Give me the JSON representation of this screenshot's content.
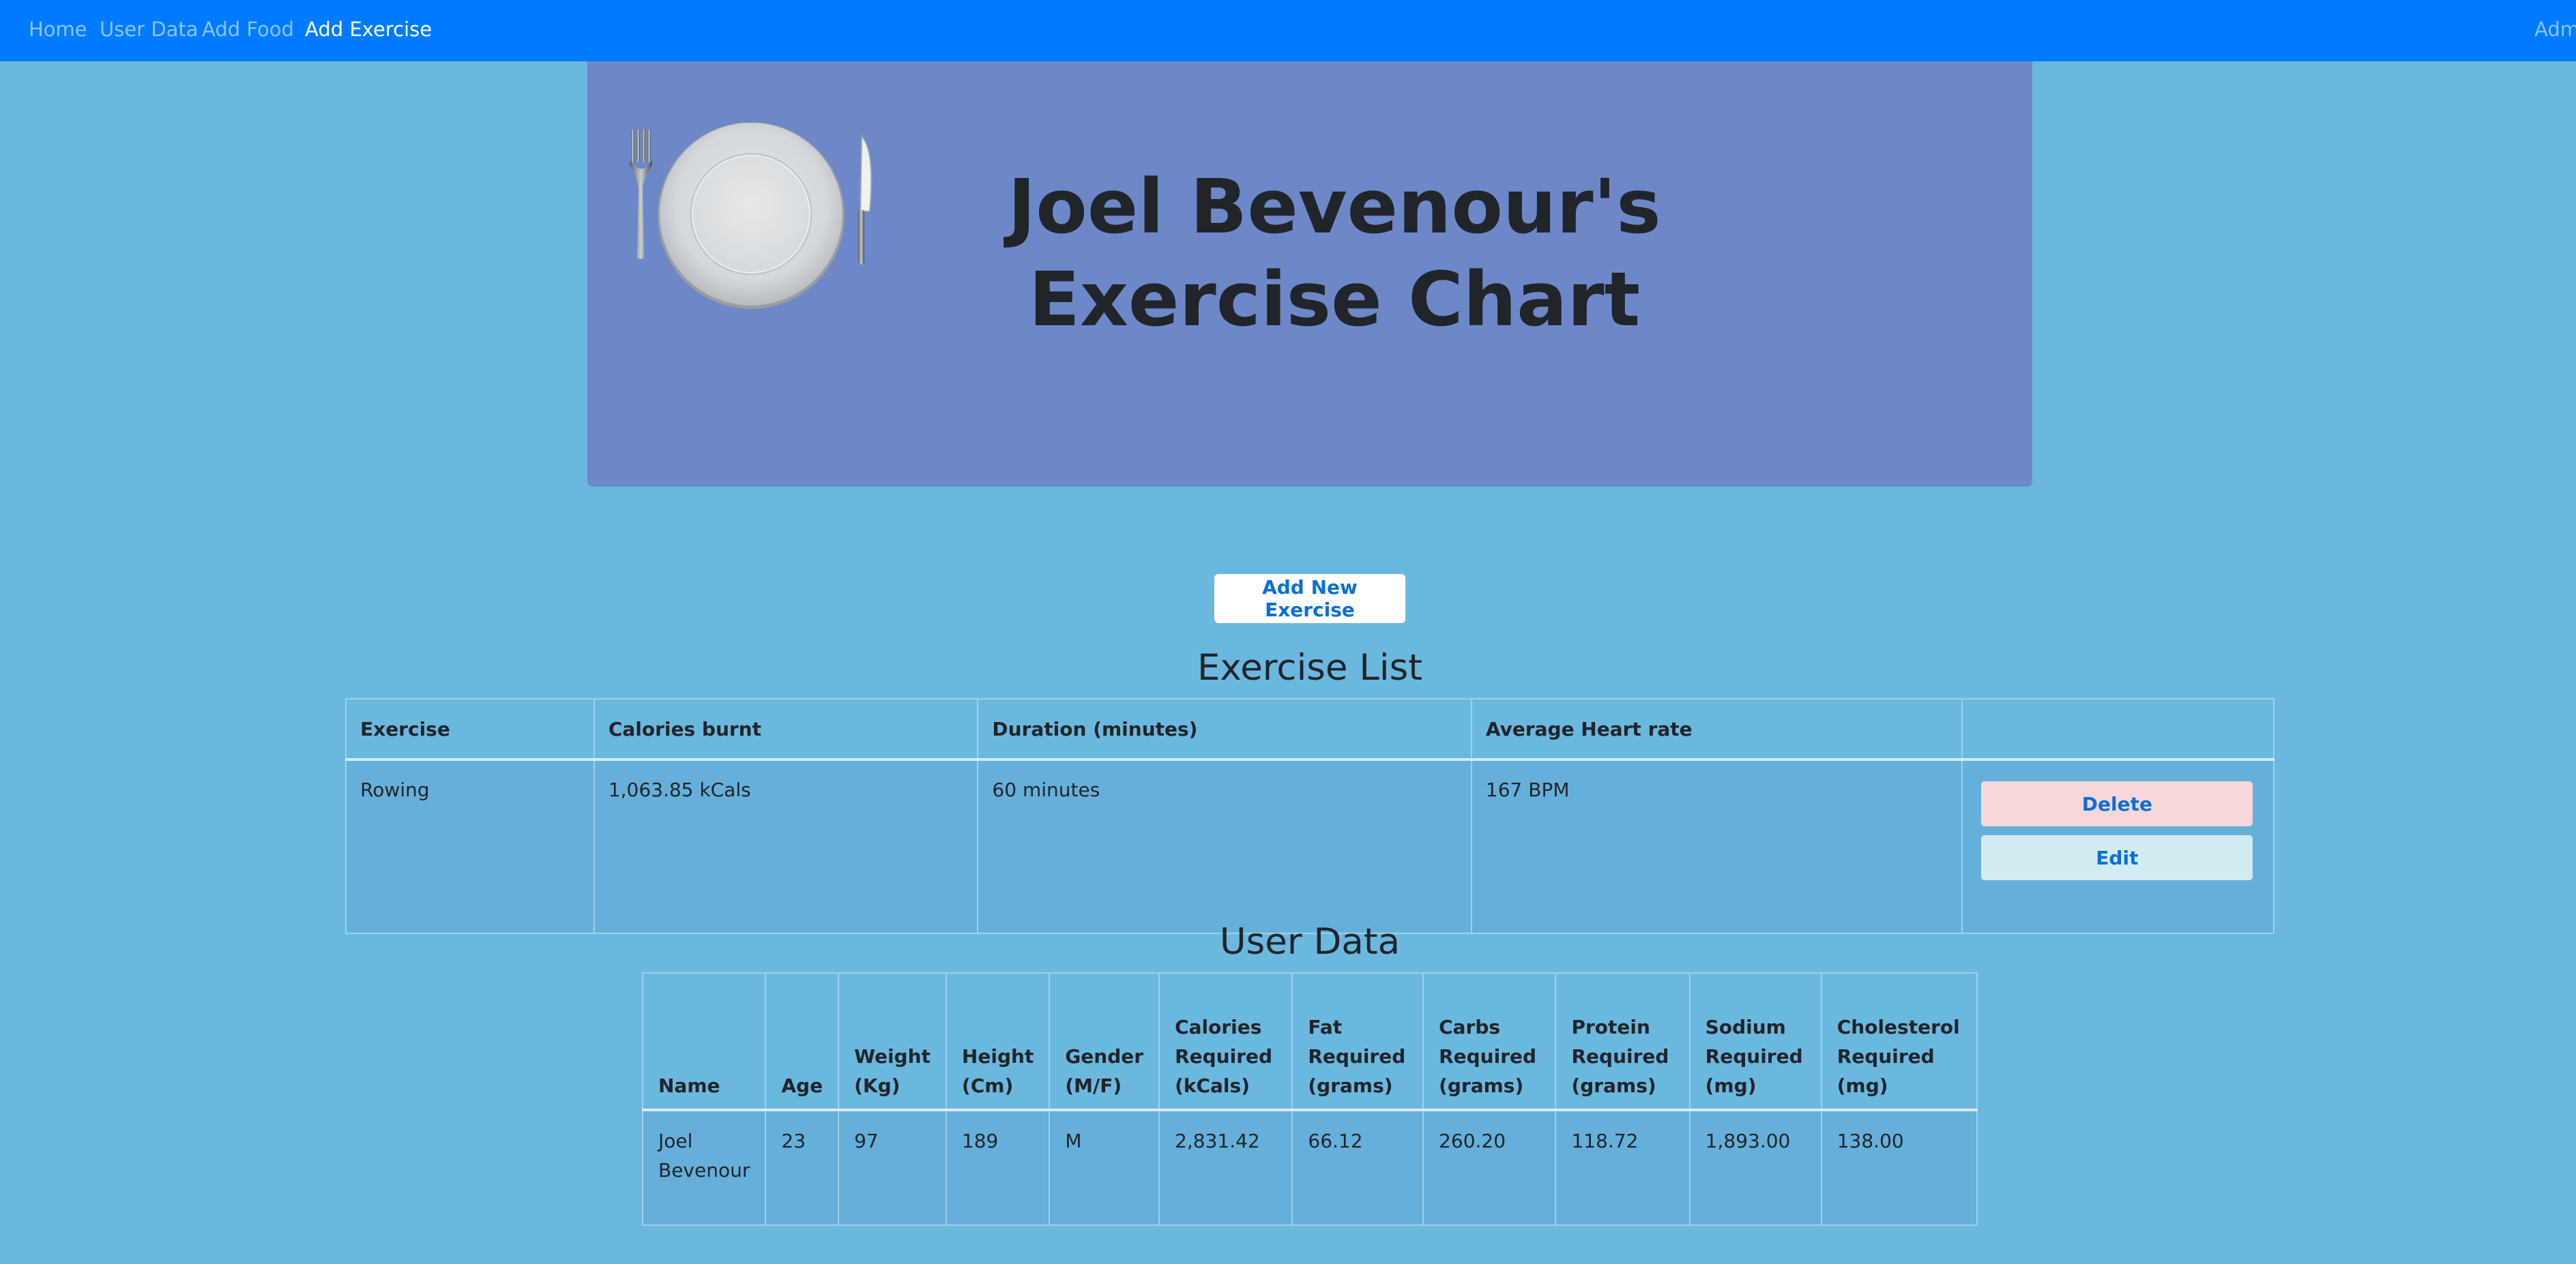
{
  "nav": {
    "items": [
      {
        "label": "Home",
        "active": false
      },
      {
        "label": "User Data",
        "active": false
      },
      {
        "label": "Add Food",
        "active": false
      },
      {
        "label": "Add Exercise",
        "active": true
      }
    ],
    "right_label": "Adm"
  },
  "hero": {
    "title": "Joel Bevenour's Exercise Chart",
    "image_icon": "plate-fork-knife-icon"
  },
  "add_button_label": "Add New Exercise",
  "exercise_list": {
    "title": "Exercise List",
    "headers": [
      "Exercise",
      "Calories burnt",
      "Duration (minutes)",
      "Average Heart rate",
      ""
    ],
    "rows": [
      {
        "exercise": "Rowing",
        "calories": "1,063.85 kCals",
        "duration": "60 minutes",
        "heart_rate": "167 BPM",
        "delete_label": "Delete",
        "edit_label": "Edit"
      }
    ]
  },
  "user_data": {
    "title": "User Data",
    "headers": [
      "Name",
      "Age",
      "Weight (Kg)",
      "Height (Cm)",
      "Gender (M/F)",
      "Calories Required (kCals)",
      "Fat Required (grams)",
      "Carbs Required (grams)",
      "Protein Required (grams)",
      "Sodium Required (mg)",
      "Cholesterol Required (mg)"
    ],
    "row": [
      "Joel Bevenour",
      "23",
      "97",
      "189",
      "M",
      "2,831.42",
      "66.12",
      "260.20",
      "118.72",
      "1,893.00",
      "138.00"
    ]
  },
  "colors": {
    "navbar": "#007bff",
    "background": "#6bb8df",
    "jumbotron": "#6d88c9",
    "button_text": "#0b6fd6",
    "delete_bg": "#f8d7da",
    "edit_bg": "#d1ecf1"
  }
}
